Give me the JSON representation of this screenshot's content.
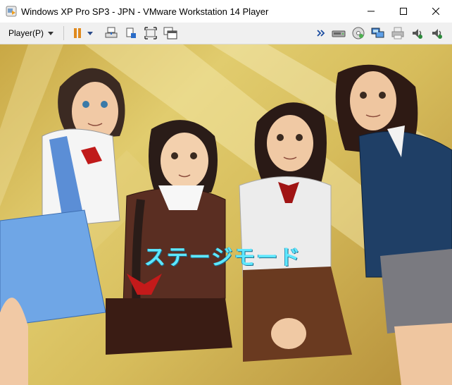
{
  "window": {
    "title": "Windows XP Pro SP3 - JPN - VMware Workstation 14 Player",
    "app_icon": "vmware-player-icon",
    "controls": [
      "minimize-icon",
      "maximize-icon",
      "close-icon"
    ]
  },
  "toolbar": {
    "player_menu_label": "Player(P)",
    "left_icons": [
      "pause-icon",
      "dropdown-caret-icon",
      "send-ctrl-alt-del-icon",
      "unity-icon",
      "fit-window-icon",
      "full-screen-icon"
    ],
    "right_icons": [
      "more-chevron-icon",
      "hard-disk-icon",
      "cd-dvd-icon",
      "network-adapter-icon",
      "printer-icon",
      "sound-card-icon",
      "sound-card-2-icon"
    ]
  },
  "guest": {
    "background": "anime-title-screen-four-schoolgirls",
    "stage_mode_text": "ステージモード",
    "colors": {
      "background": "#d7bd5c",
      "menu_text": "#5ee8ff"
    }
  }
}
